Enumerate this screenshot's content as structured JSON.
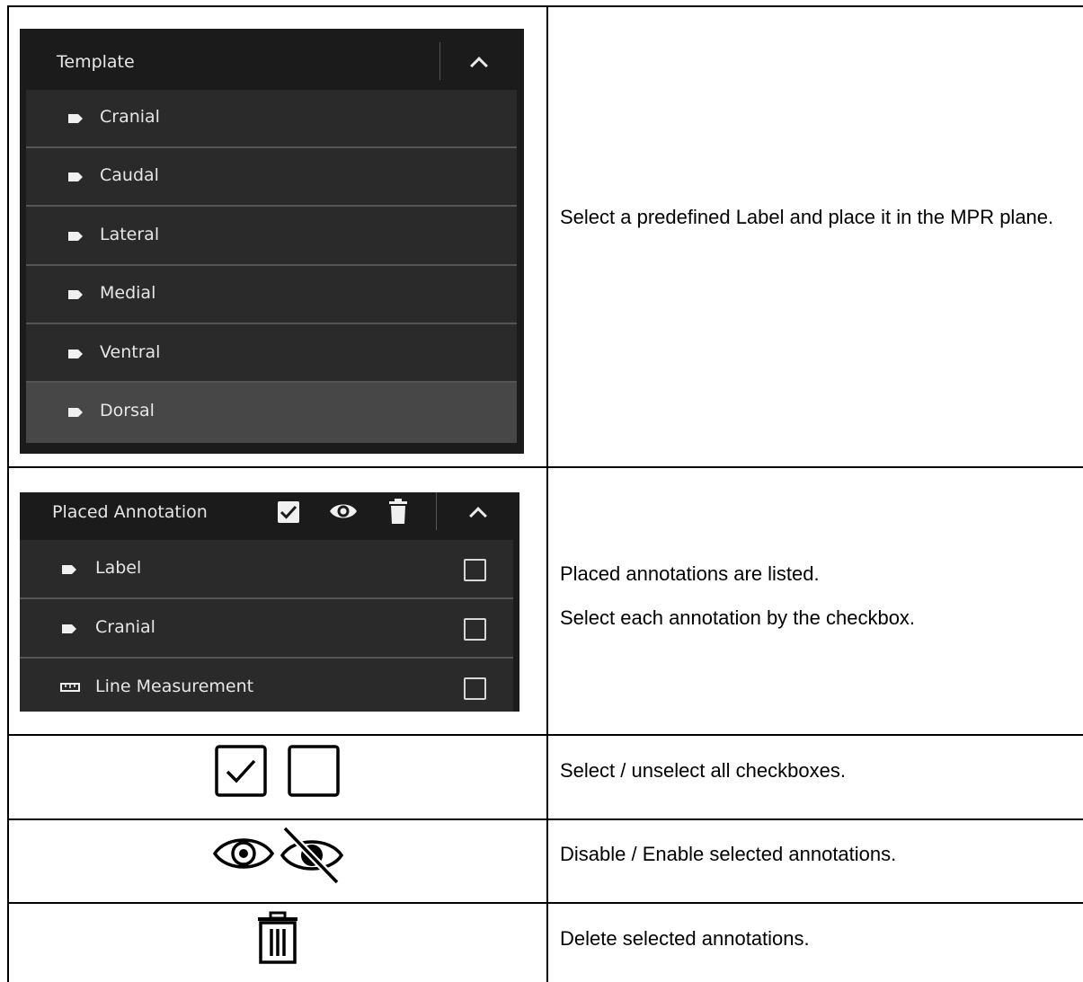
{
  "template_panel": {
    "title": "Template",
    "items": [
      {
        "label": "Cranial"
      },
      {
        "label": "Caudal"
      },
      {
        "label": "Lateral"
      },
      {
        "label": "Medial"
      },
      {
        "label": "Ventral"
      },
      {
        "label": "Dorsal",
        "selected": true
      }
    ]
  },
  "placed_panel": {
    "title": "Placed Annotation",
    "items": [
      {
        "label": "Label",
        "icon": "label-tag-icon",
        "checked": false
      },
      {
        "label": "Cranial",
        "icon": "label-tag-icon",
        "checked": false
      },
      {
        "label": "Line Measurement",
        "icon": "ruler-icon",
        "checked": false
      }
    ]
  },
  "rows": {
    "template_desc": "Select a predefined Label and place it in the MPR plane.",
    "placed_desc_1": "Placed annotations are listed.",
    "placed_desc_2": "Select each annotation by the checkbox.",
    "select_desc": "Select / unselect all checkboxes.",
    "visibility_desc": "Disable / Enable selected annotations.",
    "delete_desc": "Delete selected annotations."
  },
  "colors": {
    "panel_bg": "#1b1b1b",
    "list_bg": "#2a2a2a",
    "selected_row": "#474747",
    "text": "#e6e6e6"
  }
}
